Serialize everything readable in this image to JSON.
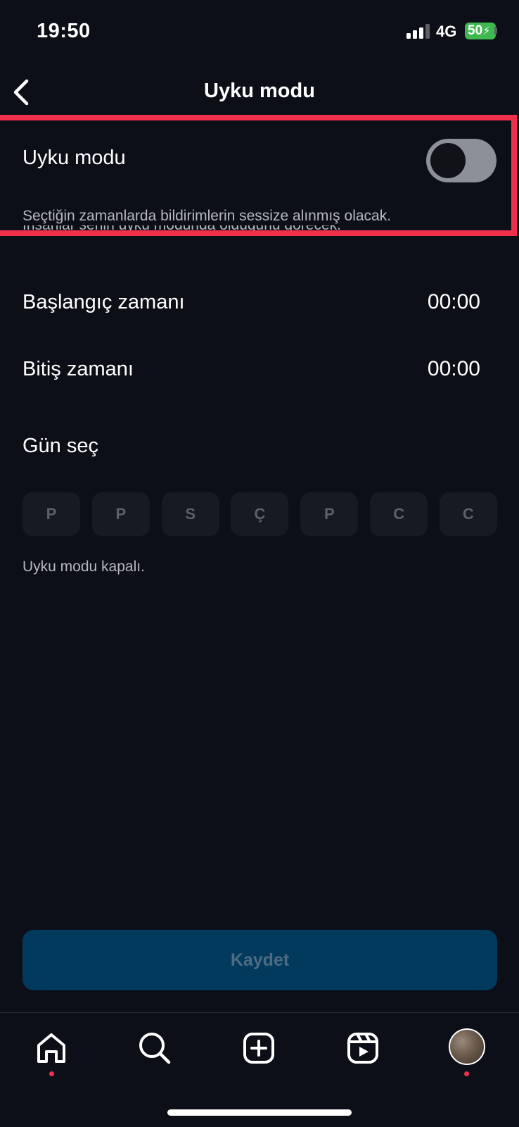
{
  "status_bar": {
    "time": "19:50",
    "network": "4G",
    "battery": "50"
  },
  "header": {
    "title": "Uyku modu"
  },
  "sleep_mode": {
    "label": "Uyku modu",
    "enabled": false,
    "description_line1": "Seçtiğin zamanlarda bildirimlerin sessize alınmış olacak.",
    "description_line2": "İnsanlar senin uyku modunda olduğunu görecek."
  },
  "schedule": {
    "start_label": "Başlangıç zamanı",
    "start_value": "00:00",
    "end_label": "Bitiş zamanı",
    "end_value": "00:00"
  },
  "days": {
    "title": "Gün seç",
    "items": [
      "P",
      "P",
      "S",
      "Ç",
      "P",
      "C",
      "C"
    ]
  },
  "status_text": "Uyku modu kapalı.",
  "save_button": "Kaydet",
  "colors": {
    "background": "#0c0f17",
    "highlight": "#f0304a",
    "save_button_bg": "#013a5c",
    "notification_dot": "#f0304a"
  }
}
